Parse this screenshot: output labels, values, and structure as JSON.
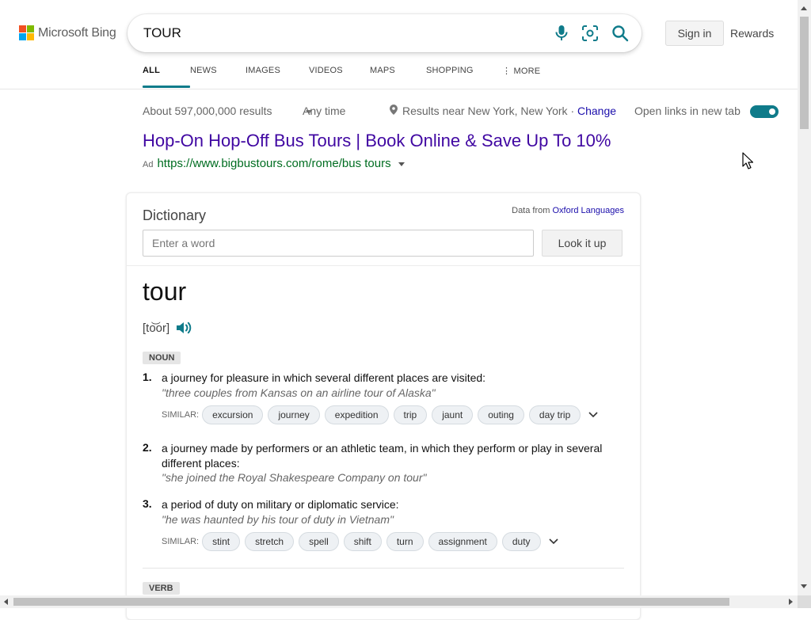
{
  "colors": {
    "accent": "#0f7b8a",
    "ad_title": "#4007a2",
    "ad_url": "#006d21",
    "link": "#1a0dab"
  },
  "header": {
    "logo_text": "Microsoft Bing",
    "search_query": "TOUR",
    "icons": [
      "microphone-icon",
      "visual-search-icon",
      "search-icon"
    ],
    "sign_in": "Sign in",
    "rewards": "Rewards",
    "nav": [
      {
        "label": "ALL",
        "active": true
      },
      {
        "label": "NEWS"
      },
      {
        "label": "IMAGES"
      },
      {
        "label": "VIDEOS"
      },
      {
        "label": "MAPS"
      },
      {
        "label": "SHOPPING"
      },
      {
        "label": "⋮ MORE"
      }
    ]
  },
  "meta": {
    "result_count": "About 597,000,000 results",
    "time_filter": "Any time",
    "location": "Results near New York, New York ·",
    "change": "Change",
    "new_tab_label": "Open links in new tab",
    "new_tab_on": true
  },
  "ad": {
    "title": "Hop-On Hop-Off Bus Tours | Book Online & Save Up To 10%",
    "badge": "Ad",
    "url": "https://www.bigbustours.com/rome/bus tours"
  },
  "dictionary": {
    "title": "Dictionary",
    "source_prefix": "Data from",
    "source_link": "Oxford Languages",
    "input_placeholder": "Enter a word",
    "lookup_button": "Look it up",
    "headword": "tour",
    "pronunciation": "[to͝or]",
    "noun_label": "NOUN",
    "similar_label": "SIMILAR:",
    "definitions": [
      {
        "num": "1.",
        "text": "a journey for pleasure in which several different places are visited:",
        "example": "\"three couples from Kansas on an airline tour of Alaska\"",
        "similar": [
          "excursion",
          "journey",
          "expedition",
          "trip",
          "jaunt",
          "outing",
          "day trip"
        ]
      },
      {
        "num": "2.",
        "text": "a journey made by performers or an athletic team, in which they perform or play in several different places:",
        "example": "\"she joined the Royal Shakespeare Company on tour\""
      },
      {
        "num": "3.",
        "text": "a period of duty on military or diplomatic service:",
        "example": "\"he was haunted by his tour of duty in Vietnam\"",
        "similar": [
          "stint",
          "stretch",
          "spell",
          "shift",
          "turn",
          "assignment",
          "duty"
        ]
      }
    ],
    "verb_label": "VERB"
  }
}
